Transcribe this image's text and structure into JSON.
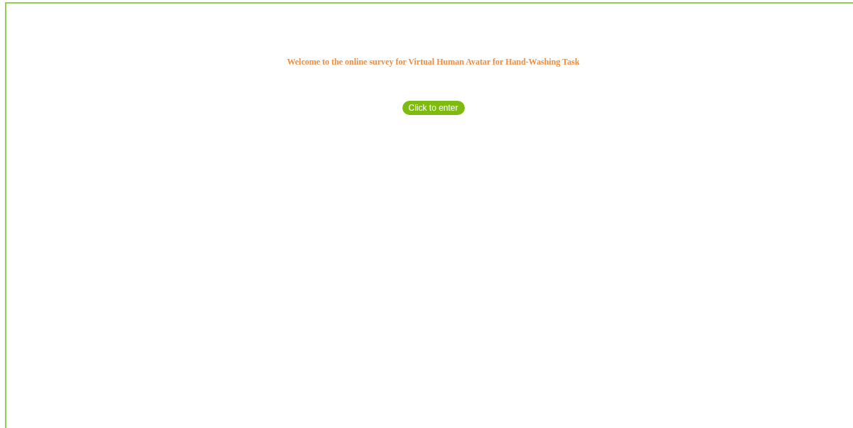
{
  "heading": "Welcome to the online survey for Virtual Human Avatar for Hand-Washing Task",
  "buttons": [
    "Click to enter"
  ]
}
